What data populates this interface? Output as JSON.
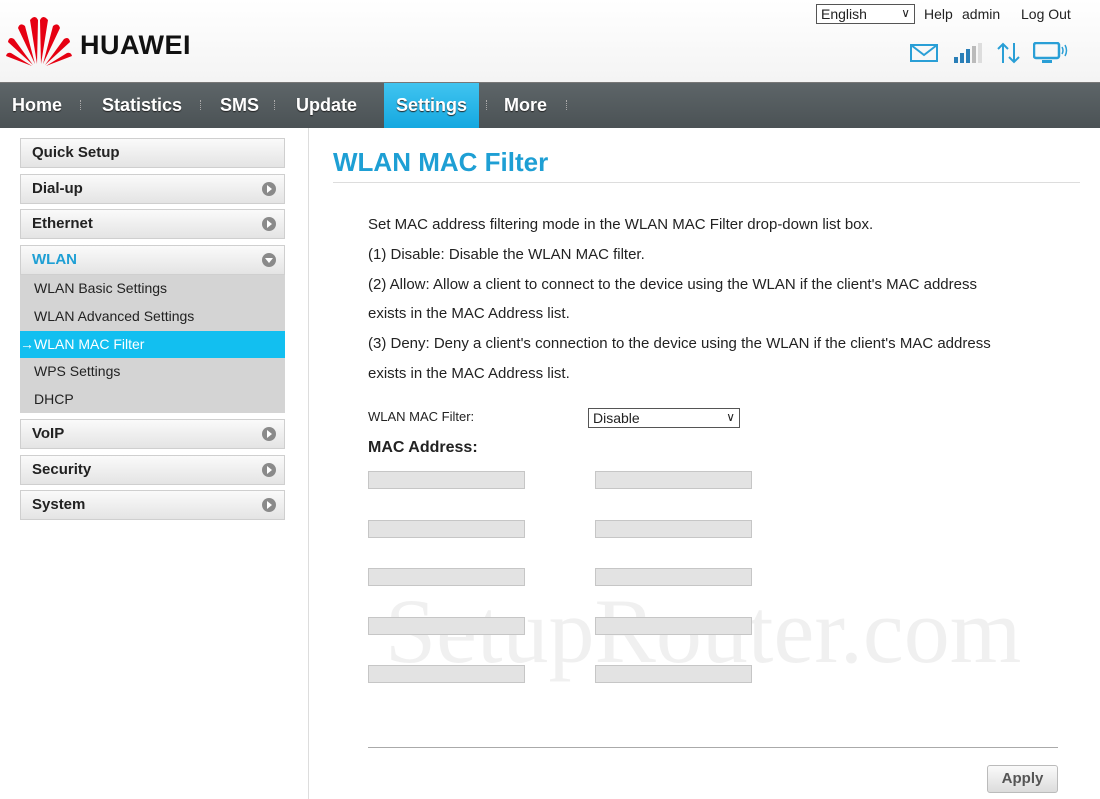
{
  "brand": {
    "name": "HUAWEI",
    "logo_color": "#e60012"
  },
  "header": {
    "language": "English",
    "help": "Help",
    "user": "admin",
    "logout": "Log Out",
    "icons": [
      "mail-icon",
      "signal-icon",
      "transfer-icon",
      "monitor-icon"
    ]
  },
  "nav": {
    "items": [
      {
        "label": "Home"
      },
      {
        "label": "Statistics"
      },
      {
        "label": "SMS"
      },
      {
        "label": "Update"
      },
      {
        "label": "Settings",
        "active": true
      },
      {
        "label": "More"
      }
    ],
    "active_color": "#1fb4e8"
  },
  "sidebar": {
    "items": [
      {
        "label": "Quick Setup"
      },
      {
        "label": "Dial-up"
      },
      {
        "label": "Ethernet"
      },
      {
        "label": "WLAN",
        "expanded": true
      },
      {
        "label": "VoIP"
      },
      {
        "label": "Security"
      },
      {
        "label": "System"
      }
    ],
    "wlan_sub": [
      {
        "label": "WLAN Basic Settings"
      },
      {
        "label": "WLAN Advanced Settings"
      },
      {
        "label": "→WLAN MAC Filter",
        "active": true
      },
      {
        "label": "WPS Settings"
      },
      {
        "label": "DHCP"
      }
    ]
  },
  "main": {
    "title": "WLAN MAC Filter",
    "description": [
      "Set MAC address filtering mode in the WLAN MAC Filter drop-down list box.",
      "(1) Disable: Disable the WLAN MAC filter.",
      "(2) Allow: Allow a client to connect to the device using the WLAN if the client's MAC address",
      "exists in the MAC Address list.",
      "(3) Deny: Deny a client's connection to the device using the WLAN if the client's MAC address",
      "exists in the MAC Address list."
    ],
    "filter_label": "WLAN MAC Filter:",
    "filter_value": "Disable",
    "mac_title": "MAC Address:",
    "mac_values": [
      "",
      "",
      "",
      "",
      "",
      "",
      "",
      "",
      "",
      ""
    ],
    "apply": "Apply"
  },
  "watermark": "SetupRouter.com"
}
